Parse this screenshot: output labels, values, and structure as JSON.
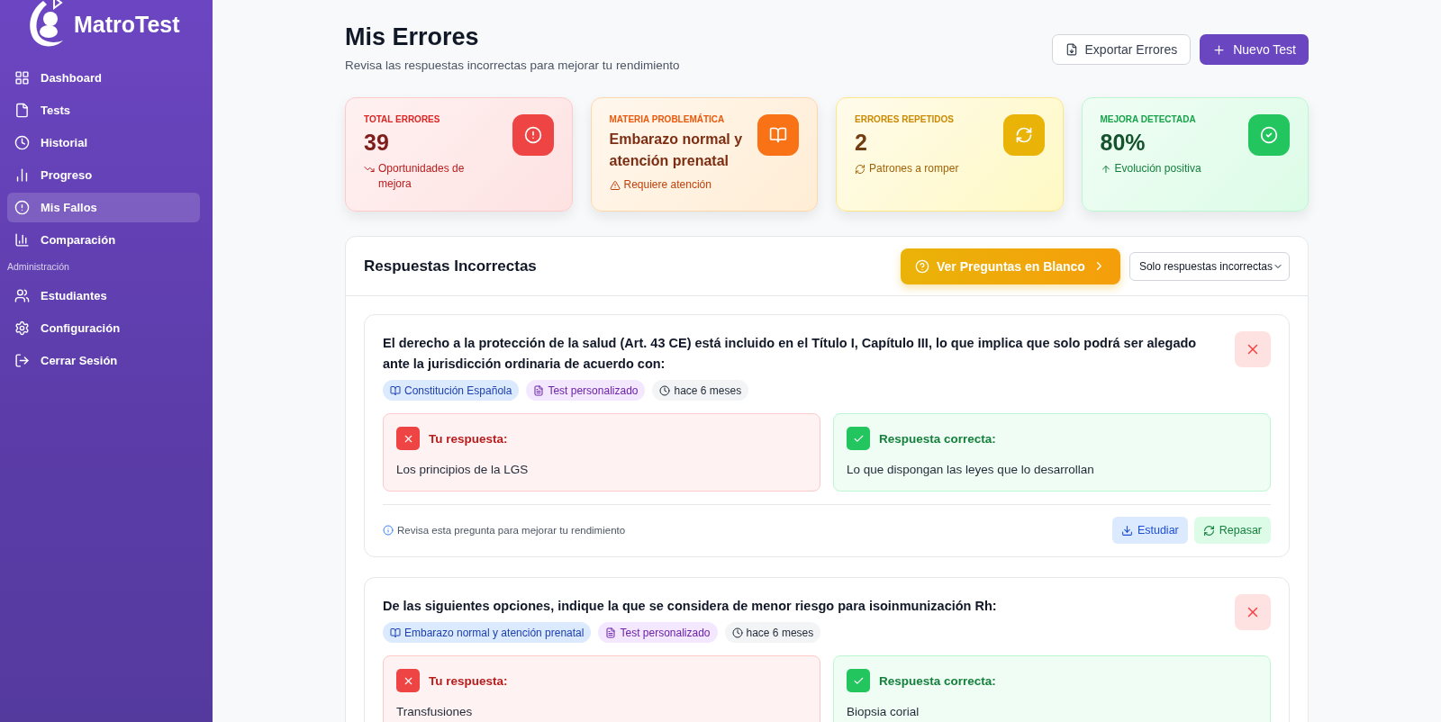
{
  "sidebar": {
    "brand": "MatroTest",
    "items": [
      {
        "label": "Dashboard",
        "selected": false
      },
      {
        "label": "Tests",
        "selected": false
      },
      {
        "label": "Historial",
        "selected": false
      },
      {
        "label": "Progreso",
        "selected": false
      },
      {
        "label": "Mis Fallos",
        "selected": true
      },
      {
        "label": "Comparación",
        "selected": false
      }
    ],
    "section_label": "Administración",
    "admin_items": [
      {
        "label": "Estudiantes",
        "selected": false
      },
      {
        "label": "Configuración",
        "selected": false
      },
      {
        "label": "Cerrar Sesión",
        "selected": false
      }
    ]
  },
  "header": {
    "title": "Mis Errores",
    "subtitle": "Revisa las respuestas incorrectas para mejorar tu rendimiento",
    "export_button": "Exportar Errores",
    "new_button": "Nuevo Test"
  },
  "stats": [
    {
      "kind": "danger",
      "label": "TOTAL ERRORES",
      "value": "39",
      "note": "Oportunidades de mejora"
    },
    {
      "kind": "warning",
      "label": "MATERIA PROBLEMÁTICA",
      "value": "Embarazo normal y atención prenatal",
      "note": "Requiere atención"
    },
    {
      "kind": "caution",
      "label": "ERRORES REPETIDOS",
      "value": "2",
      "note": "Patrones a romper"
    },
    {
      "kind": "success",
      "label": "MEJORA DETECTADA",
      "value": "80%",
      "note": "Evolución positiva"
    }
  ],
  "panel": {
    "title": "Respuestas Incorrectas",
    "blank_button": "Ver Preguntas en Blanco",
    "filter": "Solo respuestas incorrectas",
    "questions": [
      {
        "text": "El derecho a la protección de la salud (Art. 43 CE) está incluido en el Título I, Capítulo III, lo que implica que solo podrá ser alegado ante la jurisdicción ordinaria de acuerdo con:",
        "tags": [
          {
            "kind": "subject",
            "label": "Constitución Española"
          },
          {
            "kind": "test",
            "label": "Test personalizado"
          },
          {
            "kind": "time",
            "label": "hace 6 meses"
          }
        ],
        "your_label": "Tu respuesta:",
        "your_answer": "Los principios de la LGS",
        "correct_label": "Respuesta correcta:",
        "correct_answer": "Lo que dispongan las leyes que lo desarrollan",
        "hint": "Revisa esta pregunta para mejorar tu rendimiento",
        "study_button": "Estudiar",
        "review_button": "Repasar"
      },
      {
        "text": "De las siguientes opciones, indique la que se considera de menor riesgo para isoinmunización Rh:",
        "tags": [
          {
            "kind": "subject",
            "label": "Embarazo normal y atención prenatal"
          },
          {
            "kind": "test",
            "label": "Test personalizado"
          },
          {
            "kind": "time",
            "label": "hace 6 meses"
          }
        ],
        "your_label": "Tu respuesta:",
        "your_answer": "Transfusiones",
        "correct_label": "Respuesta correcta:",
        "correct_answer": "Biopsia corial"
      }
    ]
  }
}
